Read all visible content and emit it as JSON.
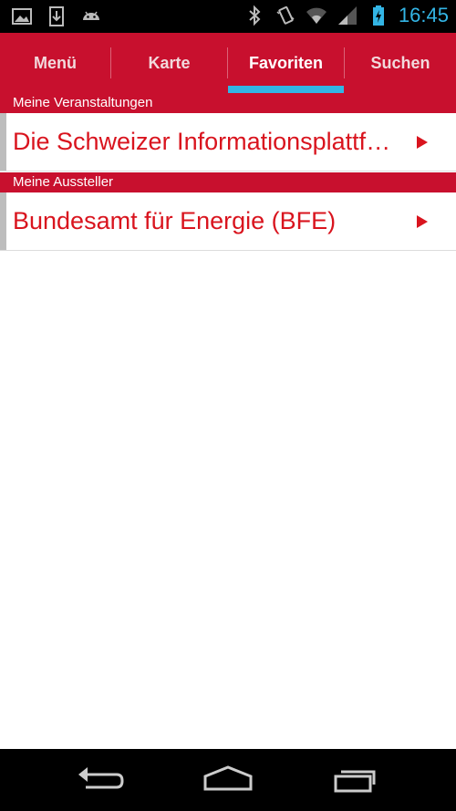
{
  "status_bar": {
    "time": "16:45",
    "left_icons": [
      "image-icon",
      "download-icon",
      "android-icon"
    ],
    "right_icons": [
      "bluetooth-icon",
      "vibrate-icon",
      "wifi-icon",
      "signal-icon",
      "battery-icon"
    ],
    "accent_color": "#33b5e5"
  },
  "tabs": [
    {
      "label": "Menü",
      "active": false
    },
    {
      "label": "Karte",
      "active": false
    },
    {
      "label": "Favoriten",
      "active": true
    },
    {
      "label": "Suchen",
      "active": false
    }
  ],
  "sections": [
    {
      "header": "Meine Veranstaltungen",
      "items": [
        {
          "label": "Die Schweizer Informationsplattform für Energie"
        }
      ]
    },
    {
      "header": "Meine Aussteller",
      "items": [
        {
          "label": "Bundesamt für Energie (BFE)"
        }
      ]
    }
  ],
  "nav_bar": {
    "buttons": [
      "back-icon",
      "home-icon",
      "recent-apps-icon"
    ]
  },
  "colors": {
    "brand_red": "#c8102e",
    "item_text_red": "#d9141e",
    "tab_indicator": "#33b5e5"
  }
}
